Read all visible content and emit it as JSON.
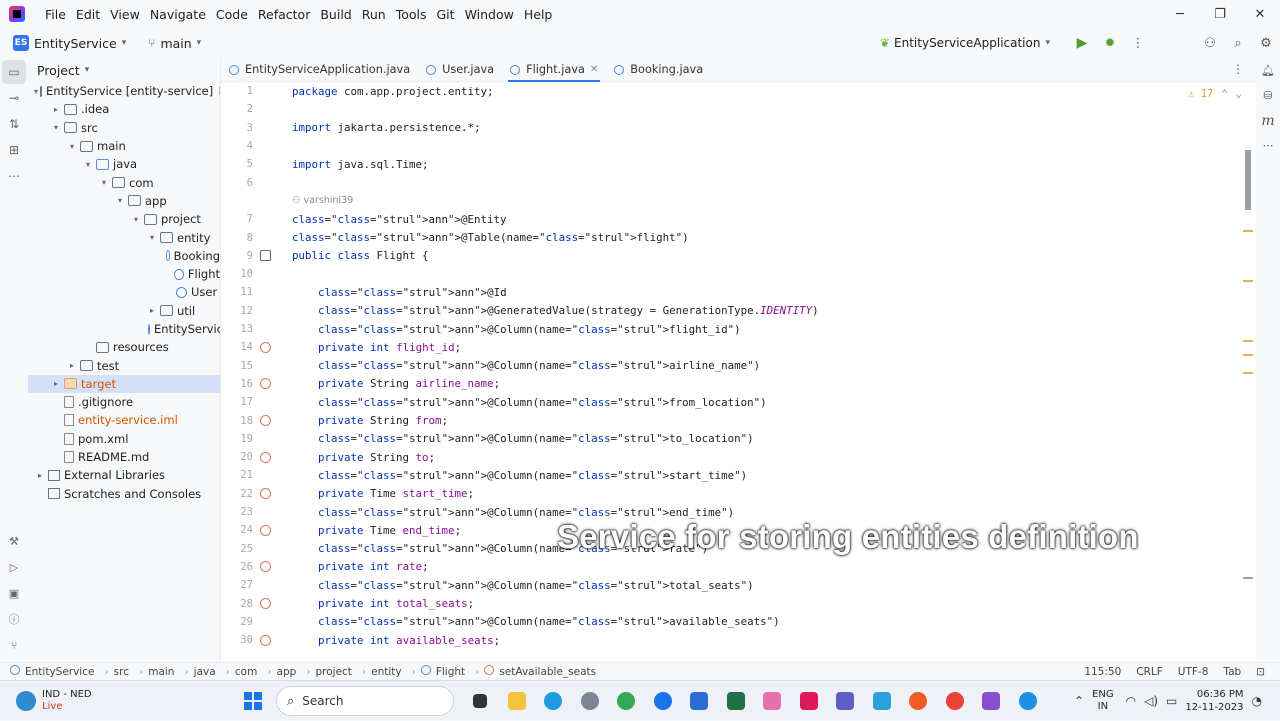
{
  "menu": [
    "File",
    "Edit",
    "View",
    "Navigate",
    "Code",
    "Refactor",
    "Build",
    "Run",
    "Tools",
    "Git",
    "Window",
    "Help"
  ],
  "toolbar": {
    "project_badge": "ES",
    "project_name": "EntityService",
    "branch": "main",
    "run_config": "EntityServiceApplication"
  },
  "project_panel": {
    "title": "Project",
    "tree": [
      {
        "label": "EntityService [entity-service]",
        "suffix": "D",
        "indent": 0,
        "arrow": "▾",
        "icon": "folder"
      },
      {
        "label": ".idea",
        "indent": 1,
        "arrow": "▸",
        "icon": "folder"
      },
      {
        "label": "src",
        "indent": 1,
        "arrow": "▾",
        "icon": "folder"
      },
      {
        "label": "main",
        "indent": 2,
        "arrow": "▾",
        "icon": "folder"
      },
      {
        "label": "java",
        "indent": 3,
        "arrow": "▾",
        "icon": "folder-blue"
      },
      {
        "label": "com",
        "indent": 4,
        "arrow": "▾",
        "icon": "folder"
      },
      {
        "label": "app",
        "indent": 5,
        "arrow": "▾",
        "icon": "folder"
      },
      {
        "label": "project",
        "indent": 6,
        "arrow": "▾",
        "icon": "folder"
      },
      {
        "label": "entity",
        "indent": 7,
        "arrow": "▾",
        "icon": "folder"
      },
      {
        "label": "Booking",
        "indent": 8,
        "arrow": "",
        "icon": "class"
      },
      {
        "label": "Flight",
        "indent": 8,
        "arrow": "",
        "icon": "class"
      },
      {
        "label": "User",
        "indent": 8,
        "arrow": "",
        "icon": "class"
      },
      {
        "label": "util",
        "indent": 7,
        "arrow": "▸",
        "icon": "folder"
      },
      {
        "label": "EntityServic",
        "indent": 7,
        "arrow": "",
        "icon": "class"
      },
      {
        "label": "resources",
        "indent": 3,
        "arrow": "",
        "icon": "folder"
      },
      {
        "label": "test",
        "indent": 2,
        "arrow": "▸",
        "icon": "folder"
      },
      {
        "label": "target",
        "indent": 1,
        "arrow": "▸",
        "icon": "folder-orange",
        "highlight": true
      },
      {
        "label": ".gitignore",
        "indent": 1,
        "arrow": "",
        "icon": "file"
      },
      {
        "label": "entity-service.iml",
        "indent": 1,
        "arrow": "",
        "icon": "file",
        "orange": true
      },
      {
        "label": "pom.xml",
        "indent": 1,
        "arrow": "",
        "icon": "file-m"
      },
      {
        "label": "README.md",
        "indent": 1,
        "arrow": "",
        "icon": "file-md"
      },
      {
        "label": "External Libraries",
        "indent": 0,
        "arrow": "▸",
        "icon": "lib"
      },
      {
        "label": "Scratches and Consoles",
        "indent": 0,
        "arrow": "",
        "icon": "lib"
      }
    ]
  },
  "tabs": [
    {
      "label": "EntityServiceApplication.java",
      "active": false
    },
    {
      "label": "User.java",
      "active": false
    },
    {
      "label": "Flight.java",
      "active": true
    },
    {
      "label": "Booking.java",
      "active": false
    }
  ],
  "editor": {
    "inspection_count": "17",
    "author": "varshini39",
    "lines": [
      {
        "n": "1",
        "text": "package com.app.project.entity;"
      },
      {
        "n": "2",
        "text": ""
      },
      {
        "n": "3",
        "text": "import jakarta.persistence.*;"
      },
      {
        "n": "4",
        "text": ""
      },
      {
        "n": "5",
        "text": "import java.sql.Time;"
      },
      {
        "n": "6",
        "text": ""
      },
      {
        "n": "7",
        "text": "@Entity"
      },
      {
        "n": "8",
        "text": "@Table(name=\"flight\")"
      },
      {
        "n": "9",
        "text": "public class Flight {",
        "gutter": "db"
      },
      {
        "n": "10",
        "text": ""
      },
      {
        "n": "11",
        "text": "    @Id"
      },
      {
        "n": "12",
        "text": "    @GeneratedValue(strategy = GenerationType.IDENTITY)"
      },
      {
        "n": "13",
        "text": "    @Column(name=\"flight_id\")"
      },
      {
        "n": "14",
        "text": "    private int flight_id;",
        "gutter": "key"
      },
      {
        "n": "15",
        "text": "    @Column(name=\"airline_name\")"
      },
      {
        "n": "16",
        "text": "    private String airline_name;",
        "gutter": "col"
      },
      {
        "n": "17",
        "text": "    @Column(name=\"from_location\")"
      },
      {
        "n": "18",
        "text": "    private String from;",
        "gutter": "col"
      },
      {
        "n": "19",
        "text": "    @Column(name=\"to_location\")"
      },
      {
        "n": "20",
        "text": "    private String to;",
        "gutter": "col"
      },
      {
        "n": "21",
        "text": "    @Column(name=\"start_time\")"
      },
      {
        "n": "22",
        "text": "    private Time start_time;",
        "gutter": "col"
      },
      {
        "n": "23",
        "text": "    @Column(name=\"end_time\")"
      },
      {
        "n": "24",
        "text": "    private Time end_time;",
        "gutter": "col"
      },
      {
        "n": "25",
        "text": "    @Column(name=\"rate\")"
      },
      {
        "n": "26",
        "text": "    private int rate;",
        "gutter": "col"
      },
      {
        "n": "27",
        "text": "    @Column(name=\"total_seats\")"
      },
      {
        "n": "28",
        "text": "    private int total_seats;",
        "gutter": "col"
      },
      {
        "n": "29",
        "text": "    @Column(name=\"available_seats\")"
      },
      {
        "n": "30",
        "text": "    private int available_seats;",
        "gutter": "col"
      }
    ]
  },
  "caption": "Service for storing entities definition",
  "statusbar": {
    "crumbs": [
      "EntityService",
      "src",
      "main",
      "java",
      "com",
      "app",
      "project",
      "entity",
      "Flight",
      "setAvailable_seats"
    ],
    "position": "115:50",
    "line_sep": "CRLF",
    "encoding": "UTF-8",
    "indent": "Tab"
  },
  "taskbar": {
    "weather_title": "IND - NED",
    "weather_sub": "Live",
    "search_placeholder": "Search",
    "lang_top": "ENG",
    "lang_bottom": "IN",
    "time": "06:36 PM",
    "date": "12-11-2023"
  }
}
